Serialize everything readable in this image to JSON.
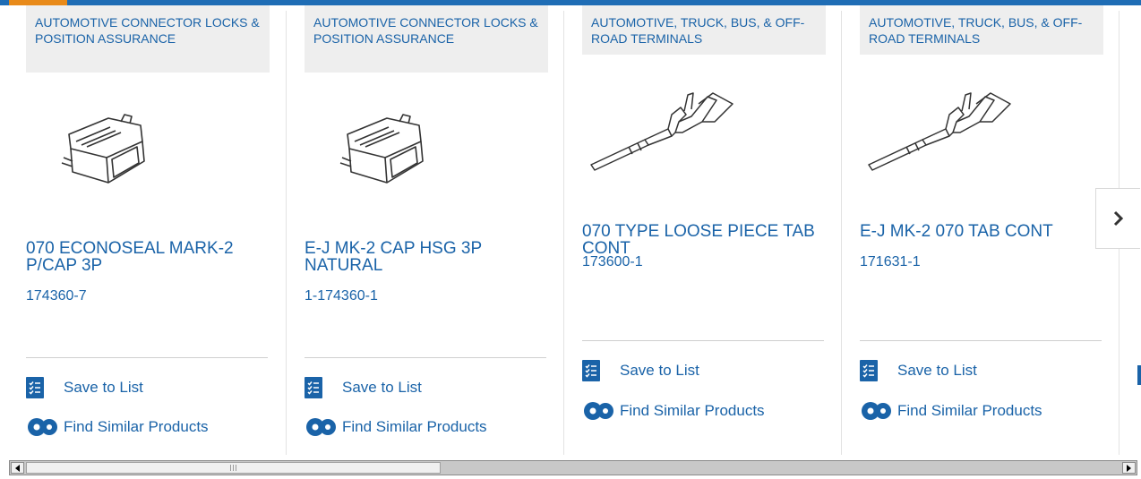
{
  "products": [
    {
      "category": "AUTOMOTIVE CONNECTOR LOCKS & POSITION ASSURANCE",
      "title": "070 ECONOSEAL MARK-2 P/CAP 3P",
      "part_number": "174360-7",
      "image_icon": "connector-housing-image"
    },
    {
      "category": "AUTOMOTIVE CONNECTOR LOCKS & POSITION ASSURANCE",
      "title": "E-J MK-2 CAP HSG 3P NATURAL",
      "part_number": "1-174360-1",
      "image_icon": "connector-housing-image"
    },
    {
      "category": "AUTOMOTIVE, TRUCK, BUS, & OFF-ROAD TERMINALS",
      "title": "070 TYPE LOOSE PIECE TAB CONT",
      "part_number": "173600-1",
      "image_icon": "terminal-image"
    },
    {
      "category": "AUTOMOTIVE, TRUCK, BUS, & OFF-ROAD TERMINALS",
      "title": "E-J MK-2 070 TAB CONT",
      "part_number": "171631-1",
      "image_icon": "terminal-image"
    }
  ],
  "actions": {
    "save_label": "Save to List",
    "similar_label": "Find Similar Products"
  },
  "navigation": {
    "next_icon": "chevron-right-icon"
  },
  "colors": {
    "link": "#1a63a8",
    "top_bar": "#1f6db5",
    "top_accent": "#e88a1a",
    "category_bg": "#eeeeee"
  }
}
